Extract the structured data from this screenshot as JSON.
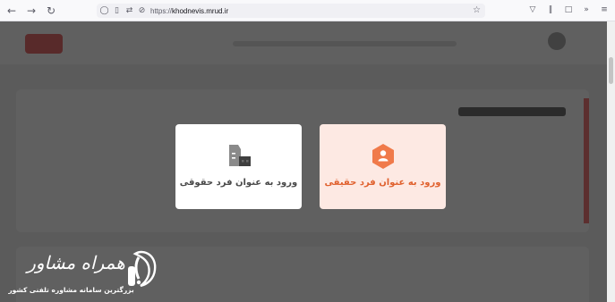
{
  "browser": {
    "url_prefix": "https://",
    "url_domain": "khodnevis.mrud.ir",
    "icons": [
      "back-icon",
      "forward-icon",
      "reload-icon",
      "shield-icon",
      "page-icon",
      "tracking-icon",
      "star-icon",
      "pocket-icon",
      "library-icon",
      "extensions-icon",
      "overflow-icon",
      "menu-icon"
    ]
  },
  "modal": {
    "options": [
      {
        "label": "ورود به عنوان فرد حقوقی",
        "icon": "building-icon"
      },
      {
        "label": "ورود به عنوان فرد حقیقی",
        "icon": "person-icon"
      }
    ]
  },
  "watermark": {
    "title": "همراه مشاور",
    "subtitle": "بزرگترین سامانه مشاوره تلفنی کشور"
  },
  "colors": {
    "overlay": "#282828",
    "real_accent": "#e0612e",
    "real_bg": "#fde9e3",
    "legal_bg": "#ffffff"
  }
}
